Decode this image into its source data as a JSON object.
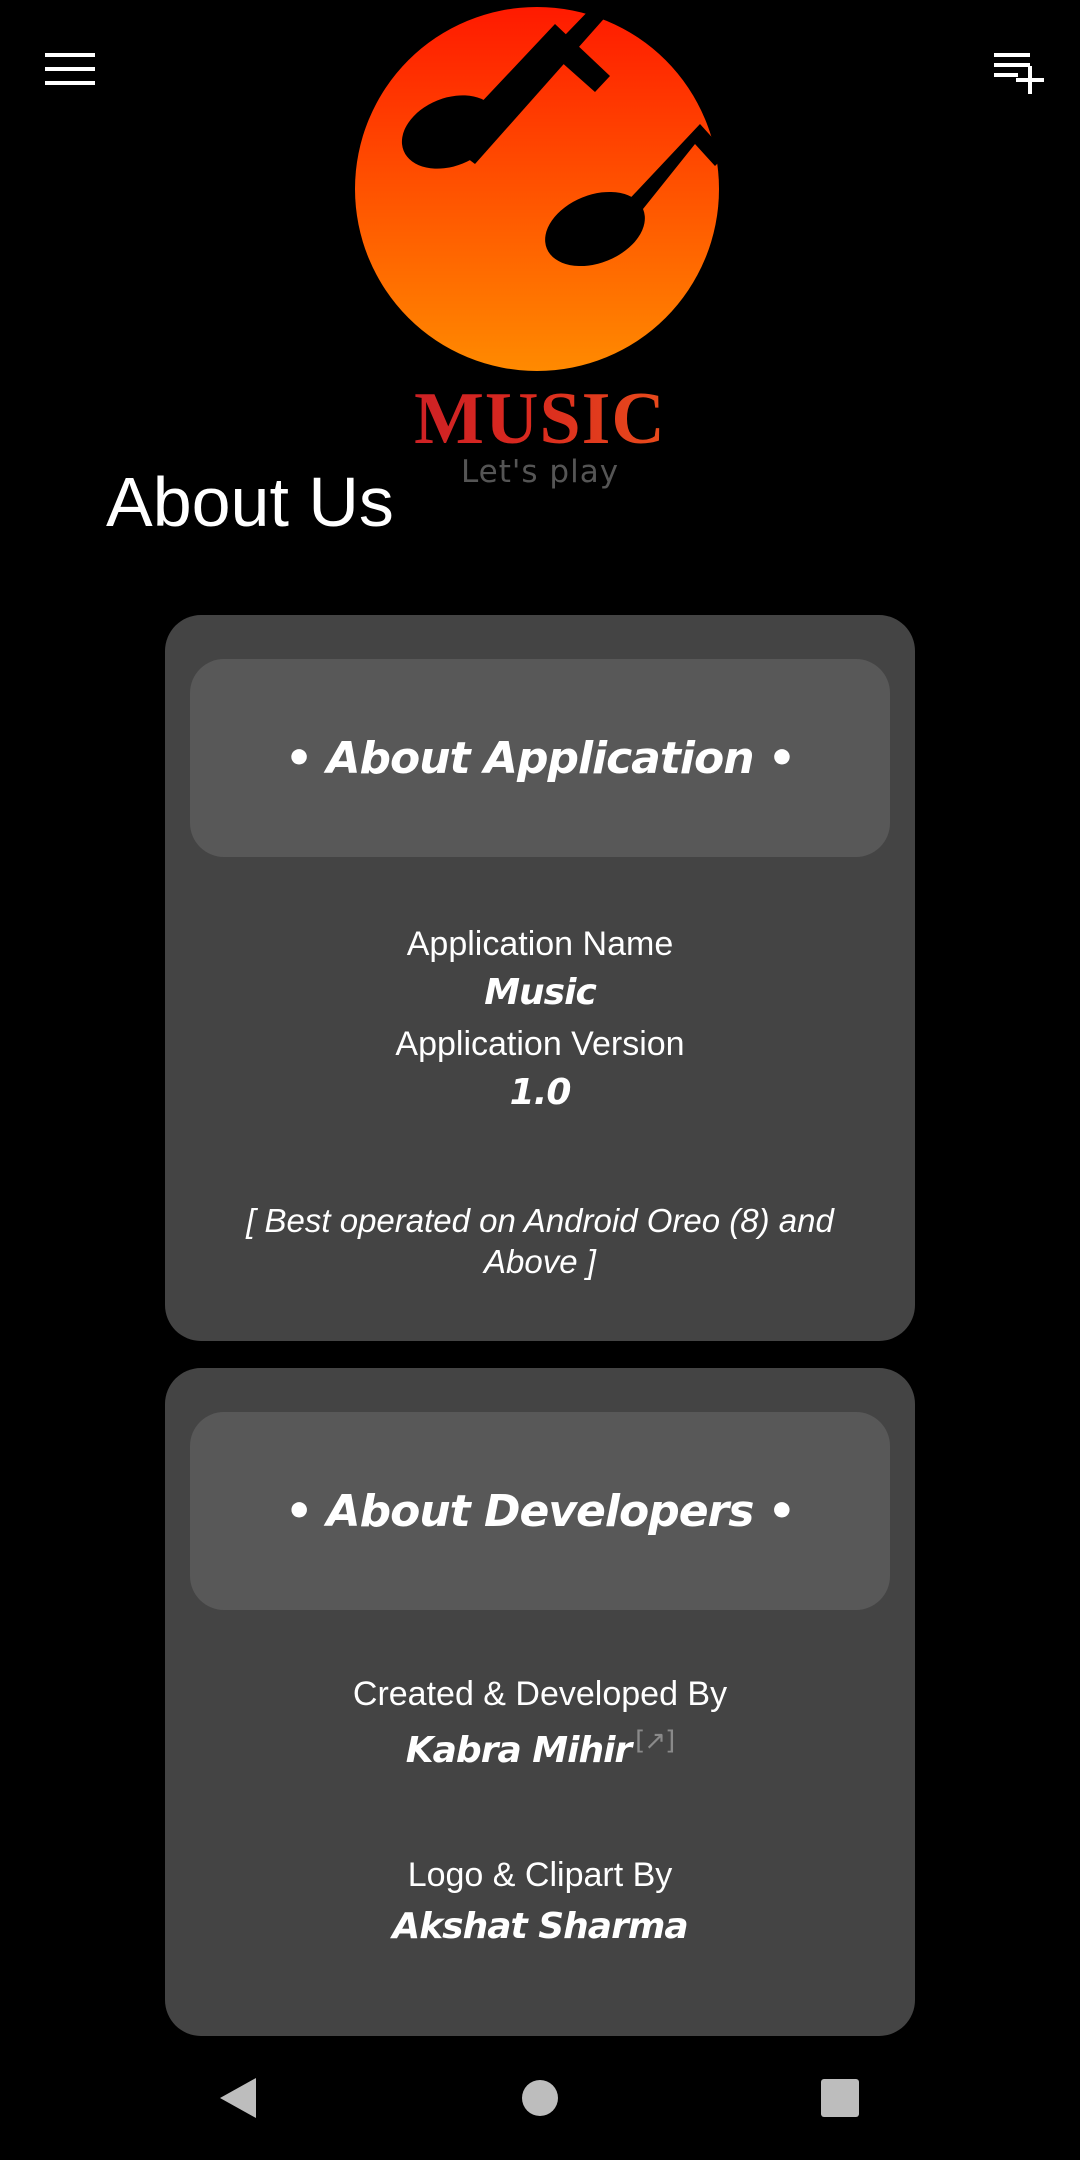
{
  "app_bar": {
    "menu_icon": "hamburger-menu-icon",
    "playlist_icon": "playlist-add-icon"
  },
  "logo": {
    "title": "MUSIC",
    "tagline": "Let's play",
    "colors": {
      "top": "#ff1a00",
      "bottom": "#ff8a00",
      "text": "#d8281f"
    }
  },
  "page": {
    "title": "About Us"
  },
  "about_application": {
    "header": "• About Application •",
    "name_label": "Application Name",
    "name_value": "Music",
    "version_label": "Application Version",
    "version_value": "1.0",
    "note": "[ Best operated on Android Oreo (8) and Above ]"
  },
  "about_developers": {
    "header": "• About Developers •",
    "created_label": "Created & Developed By",
    "developer_name": "Kabra Mihir",
    "developer_link_icon": "[↗]",
    "logo_label": "Logo & Clipart By",
    "designer_name": "Akshat Sharma"
  },
  "nav": {
    "back_icon": "back-triangle-icon",
    "home_icon": "home-circle-icon",
    "recents_icon": "recents-square-icon"
  },
  "theme": {
    "background": "#000000",
    "card": "#444444",
    "card_header": "#585858"
  }
}
